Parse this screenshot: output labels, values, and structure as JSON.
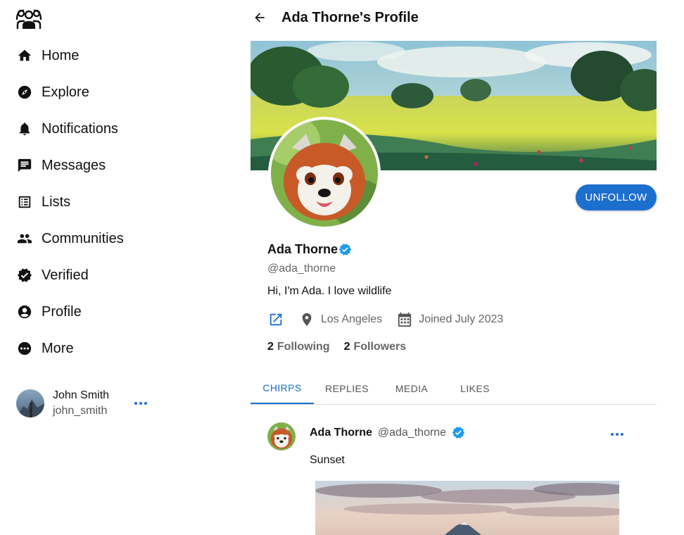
{
  "sidebar": {
    "logo": "people-group-icon",
    "items": [
      {
        "label": "Home",
        "icon": "home-icon"
      },
      {
        "label": "Explore",
        "icon": "compass-icon"
      },
      {
        "label": "Notifications",
        "icon": "bell-icon"
      },
      {
        "label": "Messages",
        "icon": "message-icon"
      },
      {
        "label": "Lists",
        "icon": "list-icon"
      },
      {
        "label": "Communities",
        "icon": "people-icon"
      },
      {
        "label": "Verified",
        "icon": "verified-badge-icon"
      },
      {
        "label": "Profile",
        "icon": "account-circle-icon"
      },
      {
        "label": "More",
        "icon": "more-circle-icon"
      }
    ],
    "account": {
      "name": "John Smith",
      "handle": "john_smith"
    }
  },
  "header": {
    "title": "Ada Thorne's Profile"
  },
  "profile": {
    "name": "Ada Thorne",
    "handle": "@ada_thorne",
    "bio": "Hi, I'm Ada. I love wildlife",
    "location": "Los Angeles",
    "joined": "Joined July 2023",
    "following_count": "2",
    "following_label": "Following",
    "followers_count": "2",
    "followers_label": "Followers",
    "unfollow_label": "UNFOLLOW"
  },
  "tabs": [
    {
      "label": "CHIRPS",
      "active": true
    },
    {
      "label": "REPLIES",
      "active": false
    },
    {
      "label": "MEDIA",
      "active": false
    },
    {
      "label": "LIKES",
      "active": false
    }
  ],
  "post": {
    "name": "Ada Thorne",
    "handle": "@ada_thorne",
    "text": "Sunset"
  },
  "colors": {
    "accent": "#1d6fce",
    "verified": "#1d9bf0",
    "muted": "#666666"
  }
}
